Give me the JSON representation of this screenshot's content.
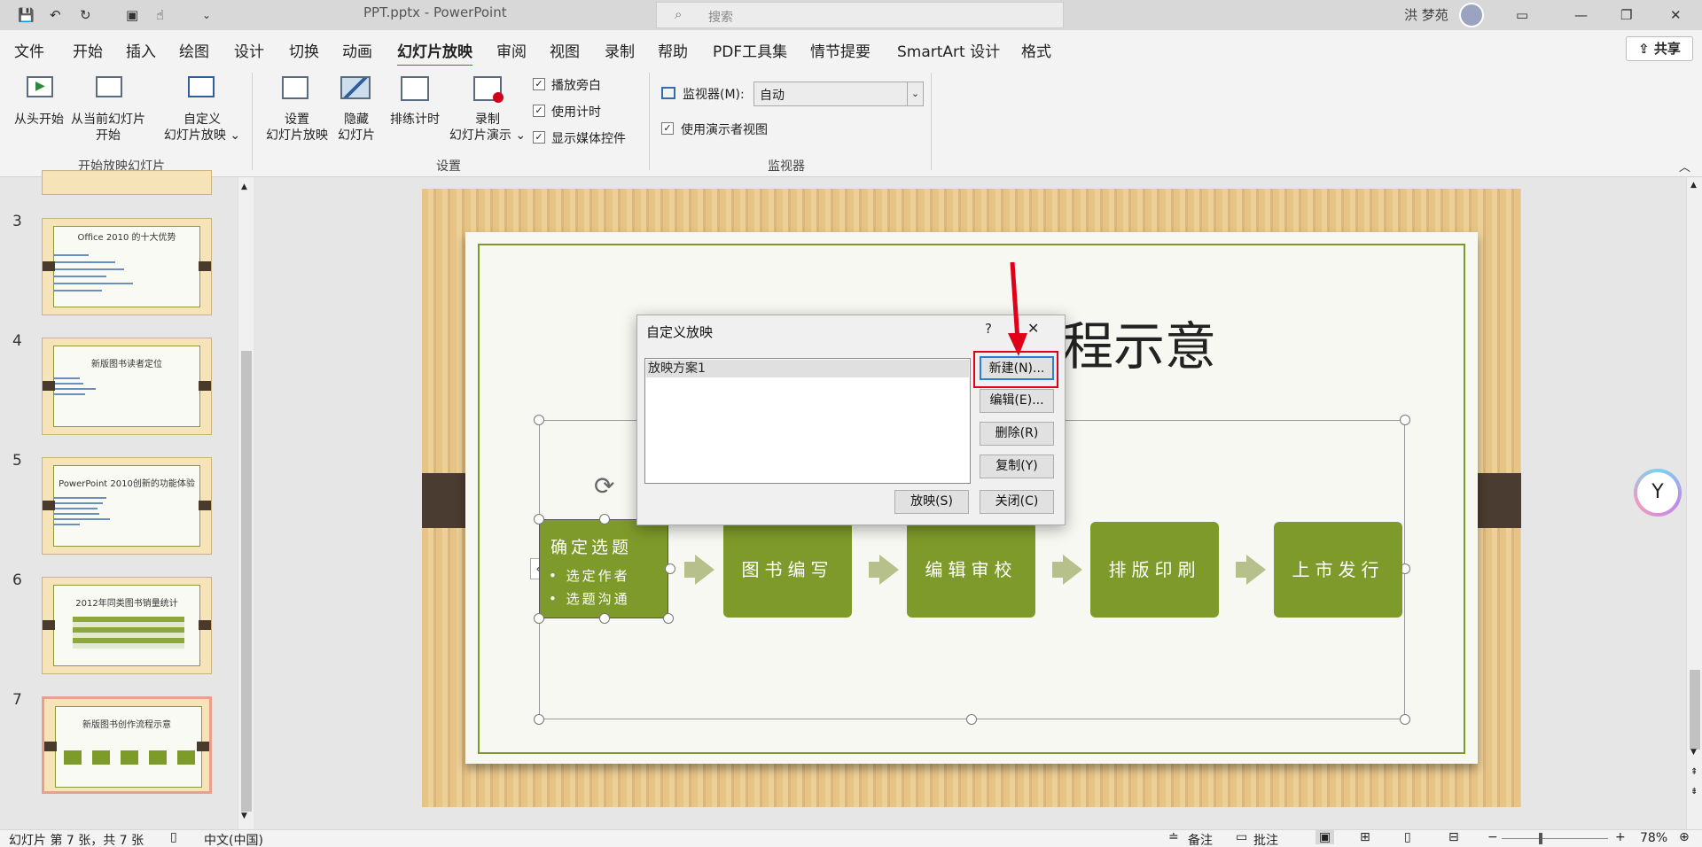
{
  "titlebar": {
    "title": "PPT.pptx  -  PowerPoint",
    "search_placeholder": "搜索",
    "user": "洪 梦苑"
  },
  "menu_tabs": [
    "文件",
    "开始",
    "插入",
    "绘图",
    "设计",
    "切换",
    "动画",
    "幻灯片放映",
    "审阅",
    "视图",
    "录制",
    "帮助",
    "PDF工具集",
    "情节提要",
    "SmartArt 设计",
    "格式"
  ],
  "active_tab": "幻灯片放映",
  "share_label": "共享",
  "ribbon": {
    "from_start": "从头开始",
    "from_current": "从当前幻灯片\n开始",
    "custom_show": "自定义\n幻灯片放映 ⌄",
    "group_start": "开始放映幻灯片",
    "setup_show": "设置\n幻灯片放映",
    "hide_slide": "隐藏\n幻灯片",
    "rehearse": "排练计时",
    "record": "录制\n幻灯片演示 ⌄",
    "play_narrations": "播放旁白",
    "use_timings": "使用计时",
    "show_media_controls": "显示媒体控件",
    "group_setup": "设置",
    "monitor_label": "监视器(M):",
    "monitor_value": "自动",
    "presenter_view": "使用演示者视图",
    "group_monitors": "监视器"
  },
  "thumbnails": [
    {
      "num": "3",
      "title": "Office 2010 的十大优势"
    },
    {
      "num": "4",
      "title": "新版图书读者定位"
    },
    {
      "num": "5",
      "title": "PowerPoint 2010创新的功能体验"
    },
    {
      "num": "6",
      "title": "2012年同类图书销量统计"
    },
    {
      "num": "7",
      "title": "新版图书创作流程示意"
    }
  ],
  "slide": {
    "title_visible": "程示意",
    "steps": [
      {
        "label": "确定选题",
        "bullets": [
          "• 选定作者",
          "• 选题沟通"
        ]
      },
      {
        "label": "图书编写"
      },
      {
        "label": "编辑审校"
      },
      {
        "label": "排版印刷"
      },
      {
        "label": "上市发行"
      }
    ]
  },
  "dialog": {
    "title": "自定义放映",
    "help": "?",
    "close_icon": "✕",
    "list_items": [
      "放映方案1"
    ],
    "new_btn": "新建(N)...",
    "edit_btn": "编辑(E)...",
    "delete_btn": "删除(R)",
    "copy_btn": "复制(Y)",
    "show_btn": "放映(S)",
    "close_btn": "关闭(C)"
  },
  "status": {
    "slide_info": "幻灯片 第 7 张，共 7 张",
    "language": "中文(中国)",
    "notes": "备注",
    "comments": "批注",
    "zoom": "78%"
  },
  "colors": {
    "accent": "#c43e1c",
    "slide_green": "#7e9a2a",
    "arrow": "#b5c08a",
    "highlight_red": "#e0001a"
  }
}
